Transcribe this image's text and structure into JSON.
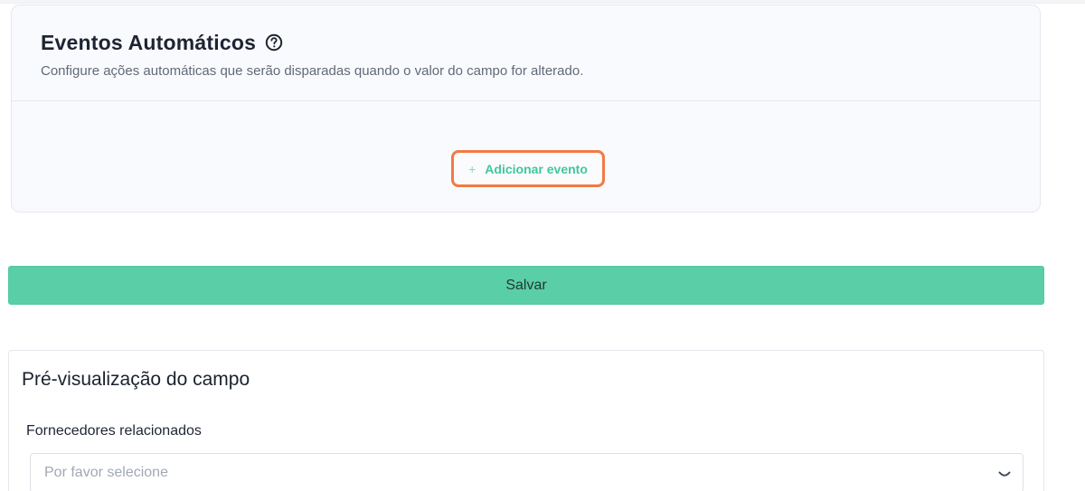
{
  "events": {
    "title": "Eventos Automáticos",
    "subtitle": "Configure ações automáticas que serão disparadas quando o valor do campo for alterado.",
    "help_icon": "question-circle-icon",
    "add_event": {
      "icon": "plus-icon",
      "label": "Adicionar evento"
    }
  },
  "save": {
    "label": "Salvar"
  },
  "preview": {
    "title": "Pré-visualização do campo",
    "field_label": "Fornecedores relacionados",
    "select": {
      "placeholder": "Por favor selecione",
      "icon": "chevron-down-icon"
    }
  },
  "colors": {
    "accent": "#5acfa7",
    "accent_text": "#3fc79c",
    "highlight_border": "#f27a43"
  }
}
